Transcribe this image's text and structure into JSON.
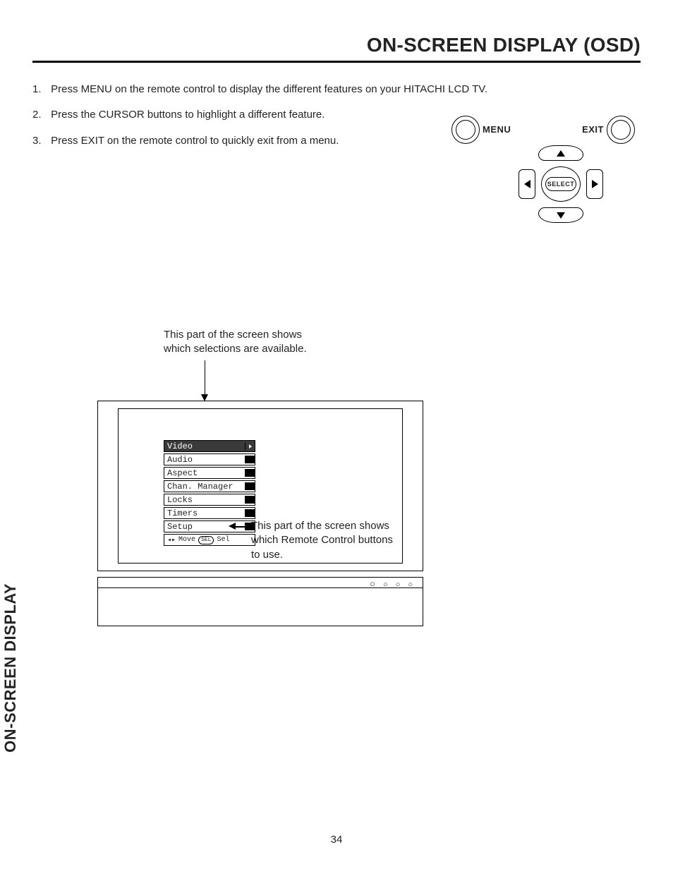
{
  "header": {
    "title": "ON-SCREEN DISPLAY (OSD)"
  },
  "side_tab": "ON-SCREEN DISPLAY",
  "instructions": [
    {
      "num": "1.",
      "text": "Press MENU on the remote control to display the different features on your HITACHI LCD TV."
    },
    {
      "num": "2.",
      "text": "Press the CURSOR buttons to highlight a different feature."
    },
    {
      "num": "3.",
      "text": "Press EXIT on the remote control to quickly exit from a menu."
    }
  ],
  "remote": {
    "menu_label": "MENU",
    "exit_label": "EXIT",
    "select_label": "SELECT"
  },
  "callout_top": {
    "line1": "This part of the screen shows",
    "line2": "which selections are available."
  },
  "osd": {
    "items": [
      "Video",
      "Audio",
      "Aspect",
      "Chan. Manager",
      "Locks",
      "Timers",
      "Setup"
    ],
    "footer_move": "Move",
    "footer_sel_pill": "SEL",
    "footer_sel": "Sel"
  },
  "callout_right": {
    "line1": "This part of the screen shows",
    "line2": "which Remote Control buttons",
    "line3": "to use."
  },
  "page_number": "34"
}
